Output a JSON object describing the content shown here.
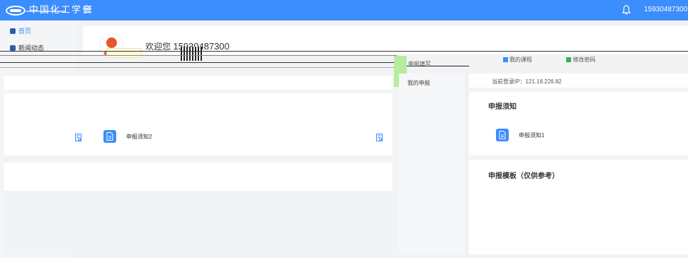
{
  "header": {
    "logo_text": "中国化工学会",
    "username": "15930487300",
    "caret": "∨"
  },
  "sidebar": {
    "items": [
      {
        "label": "首页",
        "icon": "home-icon"
      },
      {
        "label": "新闻动态",
        "icon": "news-icon"
      }
    ]
  },
  "user_card": {
    "welcome_prefix": "欢迎您",
    "phone": "15930487300"
  },
  "links": {
    "notice_fill": "申报填写",
    "my_declaration": "我的申报",
    "my_course": "我的课程",
    "change_password": "修改密码"
  },
  "ip": {
    "label": "当前登录IP：121.18.226.82"
  },
  "notices": {
    "title": "申报须知",
    "items": [
      "申报须知2",
      "申报须知1"
    ]
  },
  "templates": {
    "title": "申报模板（仅供参考）"
  },
  "colors": {
    "brand": "#3c8dfd",
    "page_bg": "#f2f3f5"
  }
}
